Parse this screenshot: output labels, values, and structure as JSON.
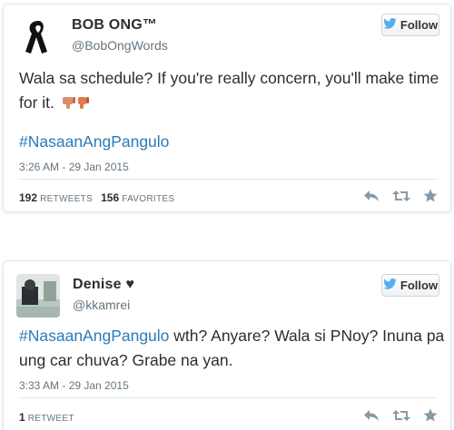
{
  "tweets": [
    {
      "name": "BOB ONG™",
      "handle": "@BobOngWords",
      "follow_label": "Follow",
      "text": "Wala sa schedule? If you're really concern, you'll make time for it.",
      "hashtag": "#NasaanAngPangulo",
      "timestamp": "3:26 AM - 29 Jan 2015",
      "retweets": "192",
      "retweets_label": "RETWEETS",
      "favorites": "156",
      "favorites_label": "FAVORITES",
      "emoji_icons": [
        "thumbs-down-icon",
        "thumbs-down-icon"
      ]
    },
    {
      "name": "Denise ♥",
      "handle": "@kkamrei",
      "follow_label": "Follow",
      "hashtag": "#NasaanAngPangulo",
      "text_rest": " wth? Anyare? Wala si PNoy? Inuna pa ung car chuva? Grabe na yan.",
      "timestamp": "3:33 AM - 29 Jan 2015",
      "retweets": "1",
      "retweets_label": "RETWEET"
    }
  ],
  "colors": {
    "link": "#2b7bb9",
    "twitter_blue": "#55acee",
    "text": "#292f33",
    "muted": "#66757f",
    "action_icon": "#8899a6"
  },
  "icons": [
    "bird-icon",
    "reply-icon",
    "retweet-icon",
    "favorite-icon"
  ]
}
